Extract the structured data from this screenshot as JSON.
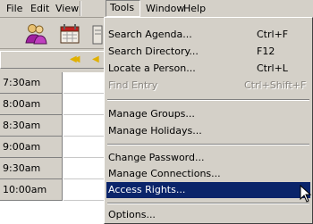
{
  "menubar": {
    "items": [
      "File",
      "Edit",
      "View",
      "Tools",
      "Window",
      "Help"
    ],
    "open_item": "Tools"
  },
  "toolbar": {
    "icons": [
      "people-icon",
      "calendar-icon",
      "document-icon"
    ]
  },
  "navbar": {
    "buttons": [
      "previous-week",
      "previous-day"
    ]
  },
  "schedule": {
    "times": [
      "7:30am",
      "8:00am",
      "8:30am",
      "9:00am",
      "9:30am",
      "10:00am"
    ]
  },
  "tools_menu": {
    "items": [
      {
        "label": "Search Agenda...",
        "shortcut": "Ctrl+F",
        "enabled": true
      },
      {
        "label": "Search Directory...",
        "shortcut": "F12",
        "enabled": true
      },
      {
        "label": "Locate a Person...",
        "shortcut": "Ctrl+L",
        "enabled": true
      },
      {
        "label": "Find Entry",
        "shortcut": "Ctrl+Shift+F",
        "enabled": false
      },
      {
        "label": "Manage Groups...",
        "shortcut": "",
        "enabled": true
      },
      {
        "label": "Manage Holidays...",
        "shortcut": "",
        "enabled": true
      },
      {
        "label": "Change Password...",
        "shortcut": "",
        "enabled": true
      },
      {
        "label": "Manage Connections...",
        "shortcut": "",
        "enabled": true
      },
      {
        "label": "Access Rights...",
        "shortcut": "",
        "enabled": true,
        "selected": true
      },
      {
        "label": "Options...",
        "shortcut": "",
        "enabled": true
      }
    ]
  },
  "colors": {
    "highlight": "#0a246a",
    "face": "#d4d0c8",
    "disabled_text": "#8a8680",
    "nav_arrow": "#e0b000"
  }
}
